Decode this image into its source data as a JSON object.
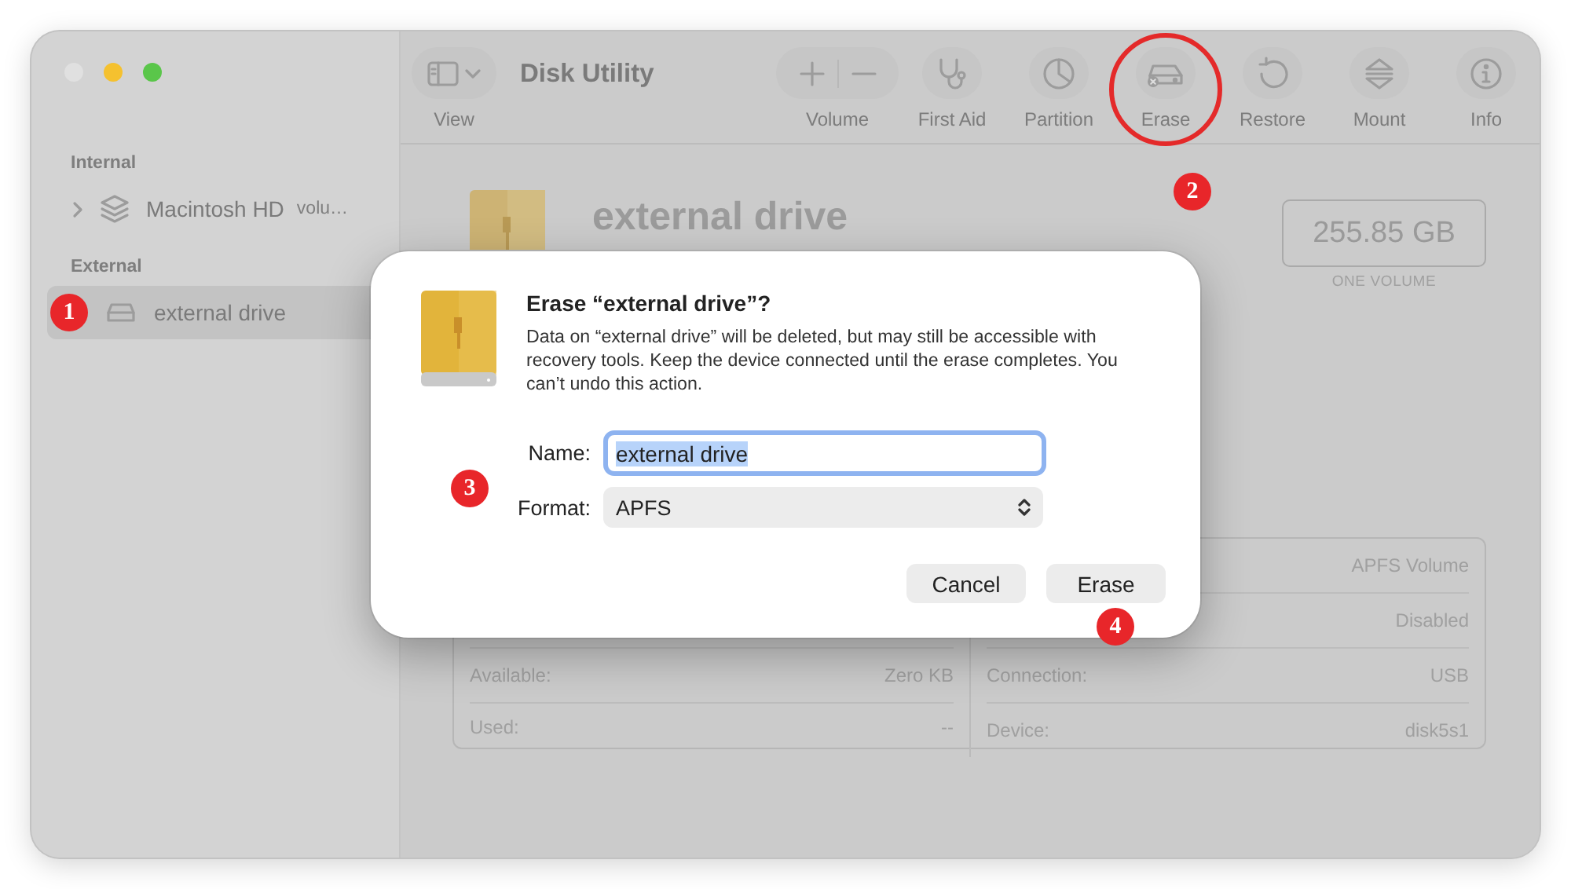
{
  "window": {
    "title": "Disk Utility"
  },
  "toolbar": {
    "view": {
      "label": "View"
    },
    "items": [
      {
        "kind": "volume",
        "label": "Volume",
        "circled": false
      },
      {
        "kind": "first_aid",
        "label": "First Aid",
        "circled": false
      },
      {
        "kind": "partition",
        "label": "Partition",
        "circled": false
      },
      {
        "kind": "erase",
        "label": "Erase",
        "circled": true
      },
      {
        "kind": "restore",
        "label": "Restore",
        "circled": false
      },
      {
        "kind": "mount",
        "label": "Mount",
        "circled": false
      },
      {
        "kind": "info",
        "label": "Info",
        "circled": false
      }
    ]
  },
  "sidebar": {
    "sections": [
      {
        "heading": "Internal",
        "items": [
          {
            "kind": "volume_group",
            "name": "Macintosh HD",
            "detail": "volu…",
            "selected": false
          }
        ]
      },
      {
        "heading": "External",
        "items": [
          {
            "kind": "drive",
            "name": "external drive",
            "selected": true
          }
        ]
      }
    ]
  },
  "drive": {
    "name": "external drive",
    "capacity": "255.85 GB",
    "capacity_note": "ONE VOLUME"
  },
  "info_table": {
    "left_rows": [
      {
        "label": "Available:",
        "value": "Zero KB"
      },
      {
        "label": "Used:",
        "value": "--"
      }
    ],
    "right_rows": [
      {
        "value": "APFS Volume"
      },
      {
        "value": "Disabled"
      },
      {
        "label": "Connection:",
        "value": "USB"
      },
      {
        "label": "Device:",
        "value": "disk5s1"
      }
    ]
  },
  "dialog": {
    "title": "Erase “external drive”?",
    "message": "Data on “external drive” will be deleted, but may still be accessible with recovery tools. Keep the device connected until the erase completes. You can’t undo this action.",
    "fields": [
      {
        "kind": "text",
        "label": "Name:",
        "value": "external drive",
        "text_selected": true
      },
      {
        "kind": "select",
        "label": "Format:",
        "value": "APFS"
      }
    ],
    "buttons": [
      {
        "label": "Cancel"
      },
      {
        "label": "Erase"
      }
    ]
  },
  "annotations": [
    {
      "number": "1"
    },
    {
      "number": "2"
    },
    {
      "number": "3"
    },
    {
      "number": "4"
    }
  ]
}
